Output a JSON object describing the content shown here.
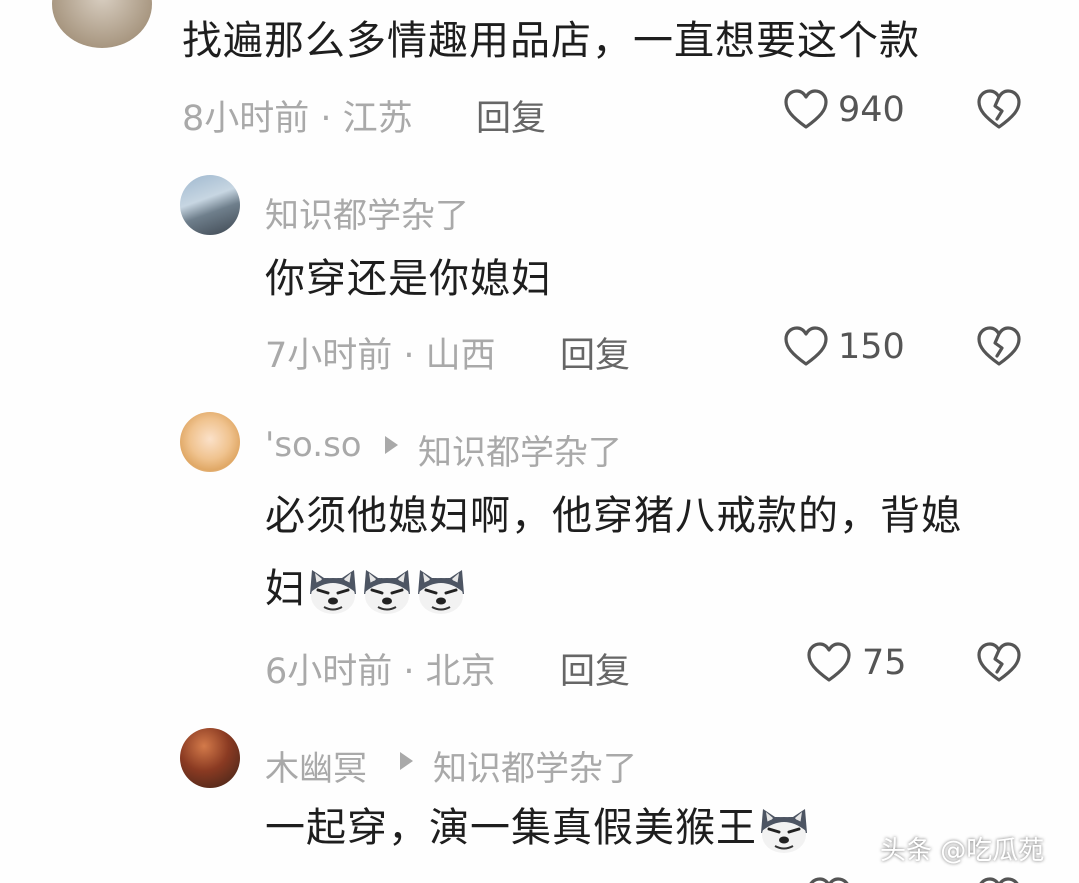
{
  "comments": [
    {
      "text": "找遍那么多情趣用品店，一直想要这个款",
      "meta": "8小时前 · 江苏",
      "reply_label": "回复",
      "likes": "940"
    },
    {
      "username": "知识都学杂了",
      "text": "你穿还是你媳妇",
      "meta": "7小时前 · 山西",
      "reply_label": "回复",
      "likes": "150"
    },
    {
      "username": "'so.so",
      "reply_to": "知识都学杂了",
      "text_line1": "必须他媳妇啊，他穿猪八戒款的，背媳",
      "text_line2": "妇",
      "emoji": "dog-emoji",
      "meta": "6小时前 · 北京",
      "reply_label": "回复",
      "likes": "75"
    },
    {
      "username": "木幽冥",
      "reply_to": "知识都学杂了",
      "text": "一起穿，演一集真假美猴王",
      "emoji": "dog-emoji"
    }
  ],
  "watermark": "头条 @吃瓜苑",
  "colors": {
    "text": "#1e1e1e",
    "meta": "#a9a9a9",
    "icon": "#555555"
  }
}
